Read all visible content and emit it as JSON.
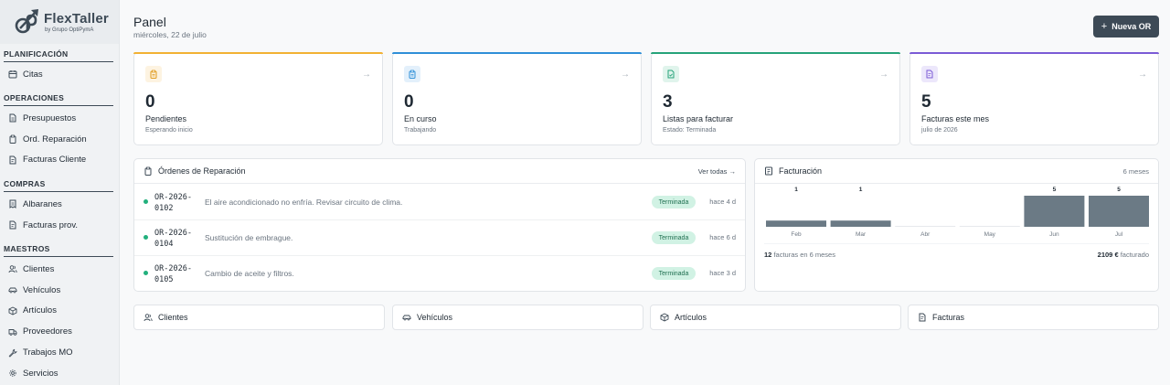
{
  "brand": {
    "name": "FlexTaller",
    "sub": "by Grupo OptiPymA"
  },
  "sidebar": {
    "sections": [
      {
        "title": "PLANIFICACIÓN",
        "items": [
          {
            "label": "Citas",
            "icon": "calendar-icon"
          }
        ]
      },
      {
        "title": "OPERACIONES",
        "items": [
          {
            "label": "Presupuestos",
            "icon": "document-icon"
          },
          {
            "label": "Ord. Reparación",
            "icon": "clipboard-icon"
          },
          {
            "label": "Facturas Cliente",
            "icon": "invoice-icon"
          }
        ]
      },
      {
        "title": "COMPRAS",
        "items": [
          {
            "label": "Albaranes",
            "icon": "receipt-icon"
          },
          {
            "label": "Facturas prov.",
            "icon": "invoice-icon"
          }
        ]
      },
      {
        "title": "MAESTROS",
        "items": [
          {
            "label": "Clientes",
            "icon": "users-icon"
          },
          {
            "label": "Vehículos",
            "icon": "car-icon"
          },
          {
            "label": "Artículos",
            "icon": "box-icon"
          },
          {
            "label": "Proveedores",
            "icon": "truck-icon"
          },
          {
            "label": "Trabajos MO",
            "icon": "wrench-icon"
          },
          {
            "label": "Servicios",
            "icon": "gear-icon"
          }
        ]
      }
    ]
  },
  "header": {
    "title": "Panel",
    "date": "miércoles, 22 de julio",
    "new_button": "Nueva OR"
  },
  "stats": [
    {
      "value": "0",
      "label": "Pendientes",
      "sub": "Esperando inicio",
      "color": "#f2b134",
      "icon_bg": "#fdf3e1",
      "icon": "clipboard-icon"
    },
    {
      "value": "0",
      "label": "En curso",
      "sub": "Trabajando",
      "color": "#2f8fd8",
      "icon_bg": "#e3f0fb",
      "icon": "clipboard-icon"
    },
    {
      "value": "3",
      "label": "Listas para facturar",
      "sub": "Estado: Terminada",
      "color": "#26a37a",
      "icon_bg": "#e0f4ec",
      "icon": "document-check-icon"
    },
    {
      "value": "5",
      "label": "Facturas este mes",
      "sub": "julio de 2026",
      "color": "#7b5bd6",
      "icon_bg": "#ece7fb",
      "icon": "invoice-icon"
    }
  ],
  "orders": {
    "title": "Órdenes de Reparación",
    "view_all": "Ver todas →",
    "rows": [
      {
        "code": "OR-2026-0102",
        "desc": "El aire acondicionado no enfría. Revisar circuito de clima.",
        "status": "Terminada",
        "ago": "hace 4 d"
      },
      {
        "code": "OR-2026-0104",
        "desc": "Sustitución de embrague.",
        "status": "Terminada",
        "ago": "hace 6 d"
      },
      {
        "code": "OR-2026-0105",
        "desc": "Cambio de aceite y filtros.",
        "status": "Terminada",
        "ago": "hace 3 d"
      }
    ]
  },
  "billing": {
    "title": "Facturación",
    "range": "6 meses",
    "footer_count": "12",
    "footer_count_label": "facturas en 6 meses",
    "footer_amount": "2109 €",
    "footer_amount_label": "facturado",
    "chart_data": {
      "type": "bar",
      "categories": [
        "Feb",
        "Mar",
        "Abr",
        "May",
        "Jun",
        "Jul"
      ],
      "values": [
        1,
        1,
        0,
        0,
        5,
        5
      ],
      "ylim": [
        0,
        5
      ],
      "bar_color": "#6b7a85"
    }
  },
  "quick_links": [
    {
      "label": "Clientes",
      "icon": "users-icon"
    },
    {
      "label": "Vehículos",
      "icon": "car-icon"
    },
    {
      "label": "Artículos",
      "icon": "box-icon"
    },
    {
      "label": "Facturas",
      "icon": "invoice-icon"
    }
  ]
}
